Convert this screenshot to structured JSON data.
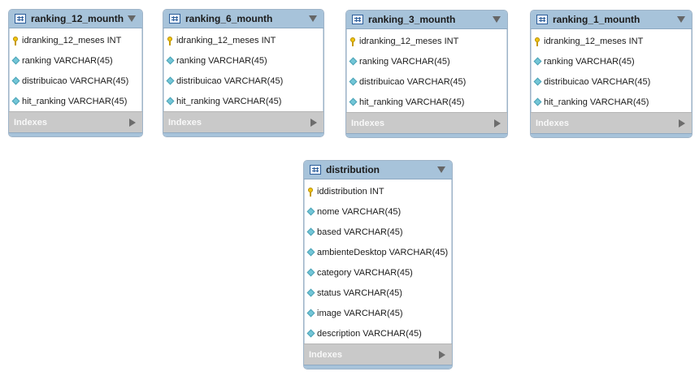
{
  "tables": [
    {
      "name": "ranking_12_mounth",
      "columns": [
        {
          "text": "idranking_12_meses INT",
          "pk": true
        },
        {
          "text": "ranking VARCHAR(45)",
          "pk": false
        },
        {
          "text": "distribuicao VARCHAR(45)",
          "pk": false
        },
        {
          "text": "hit_ranking VARCHAR(45)",
          "pk": false
        }
      ],
      "indexes_label": "Indexes"
    },
    {
      "name": "ranking_6_mounth",
      "columns": [
        {
          "text": "idranking_12_meses INT",
          "pk": true
        },
        {
          "text": "ranking VARCHAR(45)",
          "pk": false
        },
        {
          "text": "distribuicao VARCHAR(45)",
          "pk": false
        },
        {
          "text": "hit_ranking VARCHAR(45)",
          "pk": false
        }
      ],
      "indexes_label": "Indexes"
    },
    {
      "name": "ranking_3_mounth",
      "columns": [
        {
          "text": "idranking_12_meses INT",
          "pk": true
        },
        {
          "text": "ranking VARCHAR(45)",
          "pk": false
        },
        {
          "text": "distribuicao VARCHAR(45)",
          "pk": false
        },
        {
          "text": "hit_ranking VARCHAR(45)",
          "pk": false
        }
      ],
      "indexes_label": "Indexes"
    },
    {
      "name": "ranking_1_mounth",
      "columns": [
        {
          "text": "idranking_12_meses INT",
          "pk": true
        },
        {
          "text": "ranking VARCHAR(45)",
          "pk": false
        },
        {
          "text": "distribuicao VARCHAR(45)",
          "pk": false
        },
        {
          "text": "hit_ranking VARCHAR(45)",
          "pk": false
        }
      ],
      "indexes_label": "Indexes"
    },
    {
      "name": "distribution",
      "columns": [
        {
          "text": "iddistribution INT",
          "pk": true
        },
        {
          "text": "nome VARCHAR(45)",
          "pk": false
        },
        {
          "text": "based VARCHAR(45)",
          "pk": false
        },
        {
          "text": "ambienteDesktop VARCHAR(45)",
          "pk": false
        },
        {
          "text": "category VARCHAR(45)",
          "pk": false
        },
        {
          "text": "status VARCHAR(45)",
          "pk": false
        },
        {
          "text": "image VARCHAR(45)",
          "pk": false
        },
        {
          "text": "description VARCHAR(45)",
          "pk": false
        }
      ],
      "indexes_label": "Indexes"
    }
  ],
  "colors": {
    "header": "#a7c3da",
    "indexes_bar": "#c9c9c9",
    "pk_icon": "#f1c40f",
    "column_icon": "#73c6d7"
  },
  "icons": {
    "table": "table-grid-icon",
    "primary_key": "key-icon",
    "column": "diamond-column-icon",
    "collapse": "triangle-down-icon",
    "expand_indexes": "triangle-right-icon"
  }
}
